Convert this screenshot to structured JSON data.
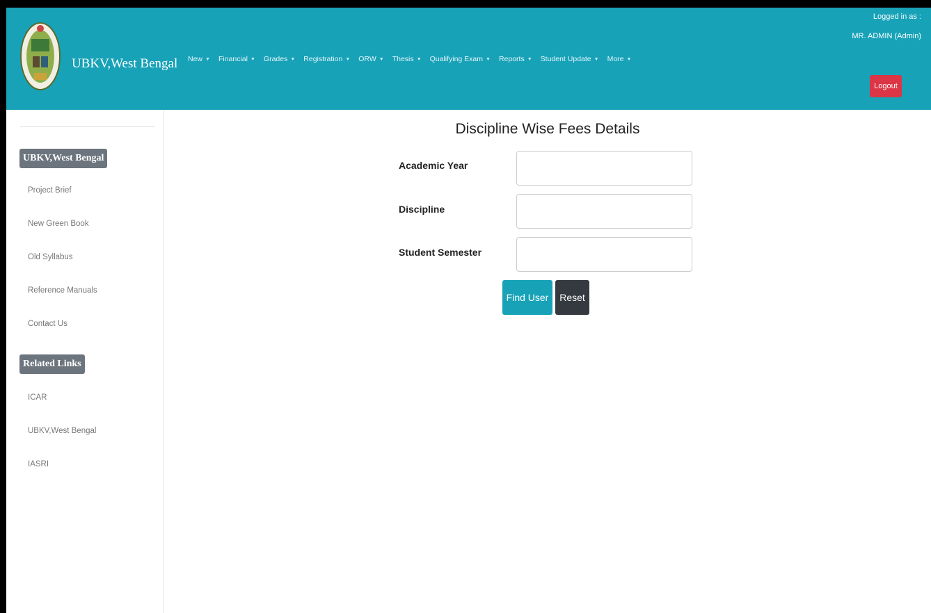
{
  "header": {
    "brand": "UBKV,West Bengal",
    "nav": [
      {
        "label": "New"
      },
      {
        "label": "Financial"
      },
      {
        "label": "Grades"
      },
      {
        "label": "Registration"
      },
      {
        "label": "ORW"
      },
      {
        "label": "Thesis"
      },
      {
        "label": "Qualifying Exam"
      },
      {
        "label": "Reports"
      },
      {
        "label": "Student Update"
      },
      {
        "label": "More"
      }
    ],
    "logged_in_label": "Logged in as :",
    "user": "MR. ADMIN (Admin)",
    "logout_label": "Logout"
  },
  "sidebar": {
    "section1_title": "UBKV,West Bengal",
    "section1_links": [
      "Project Brief",
      "New Green Book",
      "Old Syllabus",
      "Reference Manuals",
      "Contact Us"
    ],
    "section2_title": "Related Links",
    "section2_links": [
      "ICAR",
      "UBKV,West Bengal",
      "IASRI"
    ]
  },
  "main": {
    "title": "Discipline Wise Fees Details",
    "fields": [
      {
        "label": "Academic Year",
        "value": ""
      },
      {
        "label": "Discipline",
        "value": ""
      },
      {
        "label": "Student Semester",
        "value": ""
      }
    ],
    "find_button": "Find User",
    "reset_button": "Reset"
  },
  "colors": {
    "header_bg": "#17a2b8",
    "logout_bg": "#dc3545",
    "reset_bg": "#343a40",
    "badge_bg": "#6c757d"
  }
}
